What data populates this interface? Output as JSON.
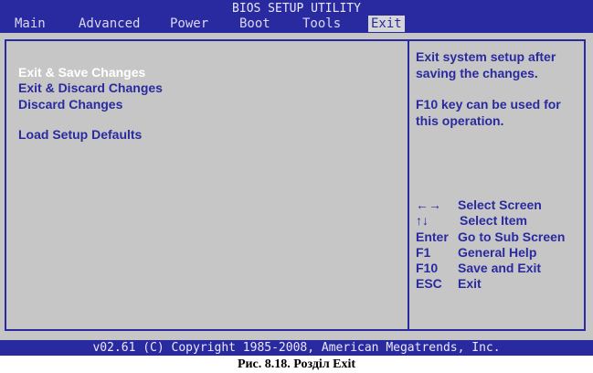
{
  "title": "BIOS SETUP UTILITY",
  "menu": [
    {
      "label": "Main"
    },
    {
      "label": "Advanced"
    },
    {
      "label": "Power"
    },
    {
      "label": "Boot"
    },
    {
      "label": "Tools"
    },
    {
      "label": "Exit",
      "active": true
    }
  ],
  "options": [
    {
      "label": "Exit & Save Changes",
      "selected": true
    },
    {
      "label": "Exit & Discard Changes"
    },
    {
      "label": "Discard Changes"
    },
    {
      "label": "Load Setup Defaults"
    }
  ],
  "help": {
    "line1": "Exit system setup after saving the changes.",
    "line2": "F10 key can be used for this operation."
  },
  "keys": [
    {
      "key": "←→",
      "desc": "Select Screen"
    },
    {
      "key": "↑↓",
      "desc": "Select Item"
    },
    {
      "key": "Enter",
      "desc": "Go to Sub Screen"
    },
    {
      "key": "F1",
      "desc": "General Help"
    },
    {
      "key": "F10",
      "desc": "Save and Exit"
    },
    {
      "key": "ESC",
      "desc": "Exit"
    }
  ],
  "footer": "v02.61 (C) Copyright 1985-2008, American Megatrends, Inc.",
  "caption": "Рис. 8.18. Розділ Exit",
  "colors": {
    "screen_blue": "#2a2aa0",
    "panel_gray": "#c6c6c6",
    "selected_text": "#ffffff"
  }
}
